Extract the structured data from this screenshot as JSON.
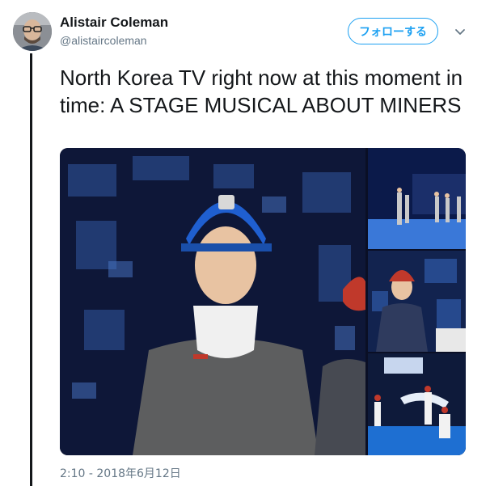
{
  "tweet": {
    "author_name": "Alistair Coleman",
    "author_handle": "@alistaircoleman",
    "follow_label": "フォローする",
    "text": "North Korea TV right now at this moment in time: A STAGE MUSICAL ABOUT MINERS",
    "timestamp": "2:10 - 2018年6月12日"
  },
  "icons": {
    "caret": "chevron-down-icon",
    "avatar": "avatar"
  },
  "colors": {
    "accent": "#1da1f2",
    "text": "#14171a",
    "secondary": "#657786"
  }
}
